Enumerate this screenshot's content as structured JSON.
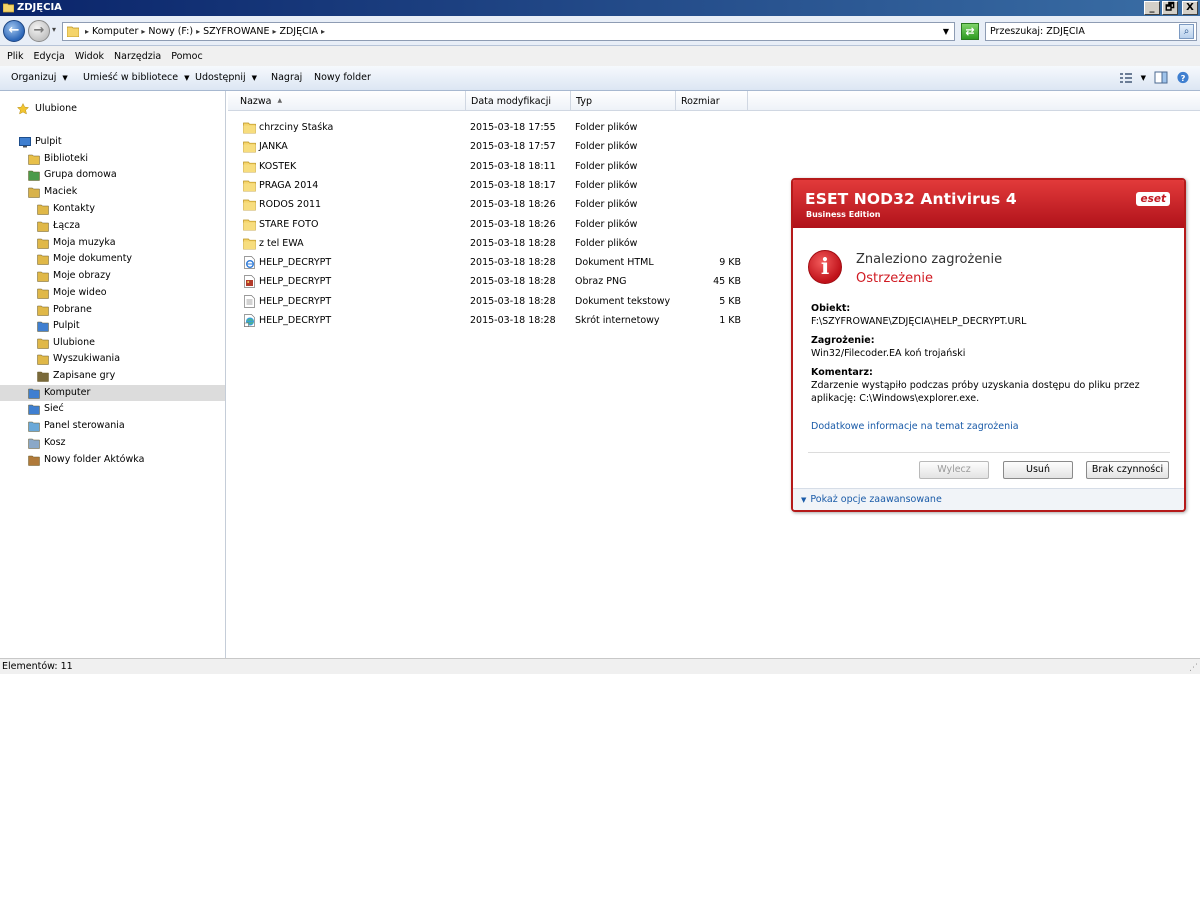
{
  "window": {
    "title": "ZDJĘCIA",
    "buttons": [
      "_",
      "🗗",
      "X"
    ]
  },
  "address": {
    "back_glyph": "←",
    "forward_glyph": "→",
    "crumbs": [
      "Komputer",
      "Nowy (F:)",
      "SZYFROWANE",
      "ZDJĘCIA"
    ],
    "search_text": "Przeszukaj: ZDJĘCIA"
  },
  "menu": [
    "Plik",
    "Edycja",
    "Widok",
    "Narzędzia",
    "Pomoc"
  ],
  "toolbar": {
    "organize": "Organizuj",
    "include_library": "Umieść w bibliotece",
    "share": "Udostępnij",
    "burn": "Nagraj",
    "new_folder": "Nowy folder"
  },
  "nav": {
    "favorites": "Ulubione",
    "desktop": "Pulpit",
    "items": [
      {
        "label": "Biblioteki",
        "icon": "libraries-icon"
      },
      {
        "label": "Grupa domowa",
        "icon": "homegroup-icon"
      },
      {
        "label": "Maciek",
        "icon": "user-folder-icon"
      },
      {
        "label": "Kontakty",
        "icon": "contacts-icon"
      },
      {
        "label": "Łącza",
        "icon": "links-icon"
      },
      {
        "label": "Moja muzyka",
        "icon": "music-folder-icon"
      },
      {
        "label": "Moje dokumenty",
        "icon": "documents-folder-icon"
      },
      {
        "label": "Moje obrazy",
        "icon": "pictures-folder-icon"
      },
      {
        "label": "Moje wideo",
        "icon": "videos-folder-icon"
      },
      {
        "label": "Pobrane",
        "icon": "downloads-folder-icon"
      },
      {
        "label": "Pulpit",
        "icon": "desktop-folder-icon"
      },
      {
        "label": "Ulubione",
        "icon": "favorites-folder-icon"
      },
      {
        "label": "Wyszukiwania",
        "icon": "searches-folder-icon"
      },
      {
        "label": "Zapisane gry",
        "icon": "saved-games-icon"
      },
      {
        "label": "Komputer",
        "icon": "computer-icon"
      },
      {
        "label": "Sieć",
        "icon": "network-icon"
      },
      {
        "label": "Panel sterowania",
        "icon": "control-panel-icon"
      },
      {
        "label": "Kosz",
        "icon": "recycle-bin-icon"
      },
      {
        "label": "Nowy folder Aktówka",
        "icon": "briefcase-icon"
      }
    ]
  },
  "columns": {
    "name": "Nazwa",
    "date": "Data modyfikacji",
    "type": "Typ",
    "size": "Rozmiar"
  },
  "files": [
    {
      "name": "chrzciny Staśka",
      "date": "2015-03-18 17:55",
      "type": "Folder plików",
      "size": "",
      "icon": "folder-icon"
    },
    {
      "name": "JANKA",
      "date": "2015-03-18 17:57",
      "type": "Folder plików",
      "size": "",
      "icon": "folder-icon"
    },
    {
      "name": "KOSTEK",
      "date": "2015-03-18 18:11",
      "type": "Folder plików",
      "size": "",
      "icon": "folder-icon"
    },
    {
      "name": "PRAGA 2014",
      "date": "2015-03-18 18:17",
      "type": "Folder plików",
      "size": "",
      "icon": "folder-icon"
    },
    {
      "name": "RODOS   2011",
      "date": "2015-03-18 18:26",
      "type": "Folder plików",
      "size": "",
      "icon": "folder-icon"
    },
    {
      "name": "STARE FOTO",
      "date": "2015-03-18 18:26",
      "type": "Folder plików",
      "size": "",
      "icon": "folder-icon"
    },
    {
      "name": "z tel EWA",
      "date": "2015-03-18 18:28",
      "type": "Folder plików",
      "size": "",
      "icon": "folder-icon"
    },
    {
      "name": "HELP_DECRYPT",
      "date": "2015-03-18 18:28",
      "type": "Dokument HTML",
      "size": "9 KB",
      "icon": "html-file-icon"
    },
    {
      "name": "HELP_DECRYPT",
      "date": "2015-03-18 18:28",
      "type": "Obraz PNG",
      "size": "45 KB",
      "icon": "png-file-icon"
    },
    {
      "name": "HELP_DECRYPT",
      "date": "2015-03-18 18:28",
      "type": "Dokument tekstowy",
      "size": "5 KB",
      "icon": "text-file-icon"
    },
    {
      "name": "HELP_DECRYPT",
      "date": "2015-03-18 18:28",
      "type": "Skrót internetowy",
      "size": "1 KB",
      "icon": "internet-shortcut-icon"
    }
  ],
  "status": {
    "text": "Elementów: 11"
  },
  "eset": {
    "title": "ESET NOD32 Antivirus 4",
    "subtitle": "Business Edition",
    "logo": "eset",
    "alert_glyph": "i",
    "heading": "Znaleziono zagrożenie",
    "severity": "Ostrzeżenie",
    "object_label": "Obiekt:",
    "object_value": "F:\\SZYFROWANE\\ZDJĘCIA\\HELP_DECRYPT.URL",
    "threat_label": "Zagrożenie:",
    "threat_value": "Win32/Filecoder.EA koń trojański",
    "comment_label": "Komentarz:",
    "comment_value": "Zdarzenie wystąpiło podczas próby uzyskania dostępu do pliku przez aplikację: C:\\Windows\\explorer.exe.",
    "more_info": "Dodatkowe informacje na temat zagrożenia",
    "btn_clean": "Wylecz",
    "btn_delete": "Usuń",
    "btn_no_action": "Brak czynności",
    "advanced": "Pokaż opcje zaawansowane"
  },
  "colors": {
    "eset_red": "#c0121a",
    "link_blue": "#1a5ba8",
    "titlebar_blue": "#0a246a"
  }
}
